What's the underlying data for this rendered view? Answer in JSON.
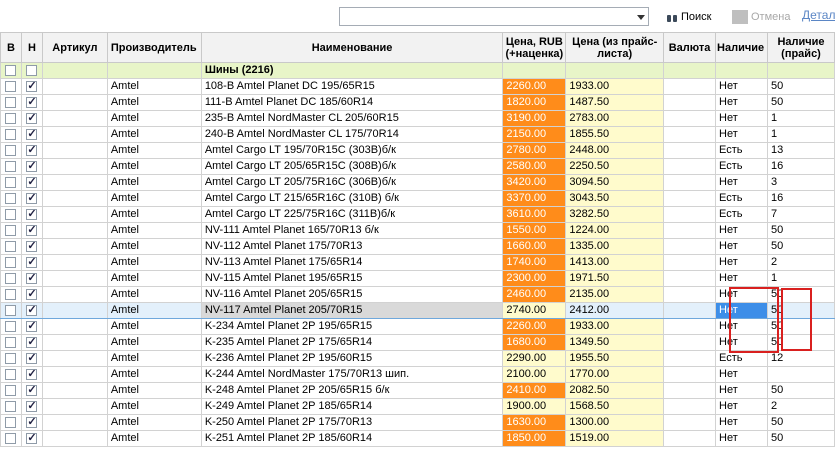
{
  "toolbar": {
    "combo_value": "",
    "search_label": "Поиск",
    "cancel_label": "Отмена",
    "details_label": "Детали"
  },
  "columns": {
    "b": "В",
    "n": "Н",
    "article": "Артикул",
    "manufacturer": "Производитель",
    "name": "Наименование",
    "price_rub": "Цена, RUB (+наценка)",
    "price_list": "Цена (из прайс-листа)",
    "currency": "Валюта",
    "availability": "Наличие",
    "availability_list": "Наличие (прайс)"
  },
  "group": {
    "label": "Шины (2216)"
  },
  "rows": [
    {
      "mfr": "Amtel",
      "name": "108-B Amtel Planet DC 195/65R15",
      "price": "2260.00",
      "list": "1933.00",
      "avail": "Нет",
      "qty": "50",
      "b": false,
      "n": true
    },
    {
      "mfr": "Amtel",
      "name": "111-B Amtel Planet DC 185/60R14",
      "price": "1820.00",
      "list": "1487.50",
      "avail": "Нет",
      "qty": "50",
      "b": false,
      "n": true
    },
    {
      "mfr": "Amtel",
      "name": "235-B Amtel NordMaster CL 205/60R15",
      "price": "3190.00",
      "list": "2783.00",
      "avail": "Нет",
      "qty": "1",
      "b": false,
      "n": true
    },
    {
      "mfr": "Amtel",
      "name": "240-B Amtel NordMaster CL 175/70R14",
      "price": "2150.00",
      "list": "1855.50",
      "avail": "Нет",
      "qty": "1",
      "b": false,
      "n": true
    },
    {
      "mfr": "Amtel",
      "name": "Amtel Cargo LT 195/70R15C  (303B)б/к",
      "price": "2780.00",
      "list": "2448.00",
      "avail": "Есть",
      "qty": "13",
      "b": false,
      "n": true
    },
    {
      "mfr": "Amtel",
      "name": "Amtel Cargo LT 205/65R15C  (308B)б/к",
      "price": "2580.00",
      "list": "2250.50",
      "avail": "Есть",
      "qty": "16",
      "b": false,
      "n": true
    },
    {
      "mfr": "Amtel",
      "name": "Amtel Cargo LT 205/75R16C  (306B)б/к",
      "price": "3420.00",
      "list": "3094.50",
      "avail": "Нет",
      "qty": "3",
      "b": false,
      "n": true
    },
    {
      "mfr": "Amtel",
      "name": "Amtel Cargo LT 215/65R16C  (310B) б/к",
      "price": "3370.00",
      "list": "3043.50",
      "avail": "Есть",
      "qty": "16",
      "b": false,
      "n": true
    },
    {
      "mfr": "Amtel",
      "name": "Amtel Cargo LT 225/75R16C  (311B)б/к",
      "price": "3610.00",
      "list": "3282.50",
      "avail": "Есть",
      "qty": "7",
      "b": false,
      "n": true
    },
    {
      "mfr": "Amtel",
      "name": "NV-111 Amtel Planet 165/70R13 б/к",
      "price": "1550.00",
      "list": "1224.00",
      "avail": "Нет",
      "qty": "50",
      "b": false,
      "n": true
    },
    {
      "mfr": "Amtel",
      "name": "NV-112 Amtel Planet 175/70R13",
      "price": "1660.00",
      "list": "1335.00",
      "avail": "Нет",
      "qty": "50",
      "b": false,
      "n": true
    },
    {
      "mfr": "Amtel",
      "name": "NV-113 Amtel Planet 175/65R14",
      "price": "1740.00",
      "list": "1413.00",
      "avail": "Нет",
      "qty": "2",
      "b": false,
      "n": true
    },
    {
      "mfr": "Amtel",
      "name": "NV-115 Amtel Planet 195/65R15",
      "price": "2300.00",
      "list": "1971.50",
      "avail": "Нет",
      "qty": "1",
      "b": false,
      "n": true
    },
    {
      "mfr": "Amtel",
      "name": "NV-116 Amtel Planet 205/65R15",
      "price": "2460.00",
      "list": "2135.00",
      "avail": "Нет",
      "qty": "50",
      "b": false,
      "n": true
    },
    {
      "mfr": "Amtel",
      "name": "NV-117 Amtel Planet 205/70R15",
      "price": "2740.00",
      "list": "2412.00",
      "avail": "Нет",
      "qty": "50",
      "b": false,
      "n": true,
      "selected": true
    },
    {
      "mfr": "Amtel",
      "name": "K-234 Amtel Planet 2P 195/65R15",
      "price": "2260.00",
      "list": "1933.00",
      "avail": "Нет",
      "qty": "50",
      "b": false,
      "n": true
    },
    {
      "mfr": "Amtel",
      "name": "K-235 Amtel Planet 2P 175/65R14",
      "price": "1680.00",
      "list": "1349.50",
      "avail": "Нет",
      "qty": "50",
      "b": false,
      "n": true
    },
    {
      "mfr": "Amtel",
      "name": "K-236 Amtel Planet 2P 195/60R15",
      "price": "2290.00",
      "list": "1955.50",
      "avail": "Есть",
      "qty": "12",
      "b": false,
      "n": true,
      "yellow": true
    },
    {
      "mfr": "Amtel",
      "name": "K-244 Amtel NordMaster 175/70R13 шип.",
      "price": "2100.00",
      "list": "1770.00",
      "avail": "Нет",
      "qty": "",
      "b": false,
      "n": true,
      "yellow": true
    },
    {
      "mfr": "Amtel",
      "name": "K-248 Amtel Planet 2P 205/65R15 б/к",
      "price": "2410.00",
      "list": "2082.50",
      "avail": "Нет",
      "qty": "50",
      "b": false,
      "n": true
    },
    {
      "mfr": "Amtel",
      "name": "K-249 Amtel Planet 2P 185/65R14",
      "price": "1900.00",
      "list": "1568.50",
      "avail": "Нет",
      "qty": "2",
      "b": false,
      "n": true,
      "yellow": true
    },
    {
      "mfr": "Amtel",
      "name": "K-250 Amtel Planet 2P 175/70R13",
      "price": "1630.00",
      "list": "1300.00",
      "avail": "Нет",
      "qty": "50",
      "b": false,
      "n": true
    },
    {
      "mfr": "Amtel",
      "name": "K-251 Amtel Planet 2P 185/60R14",
      "price": "1850.00",
      "list": "1519.00",
      "avail": "Нет",
      "qty": "50",
      "b": false,
      "n": true
    }
  ]
}
